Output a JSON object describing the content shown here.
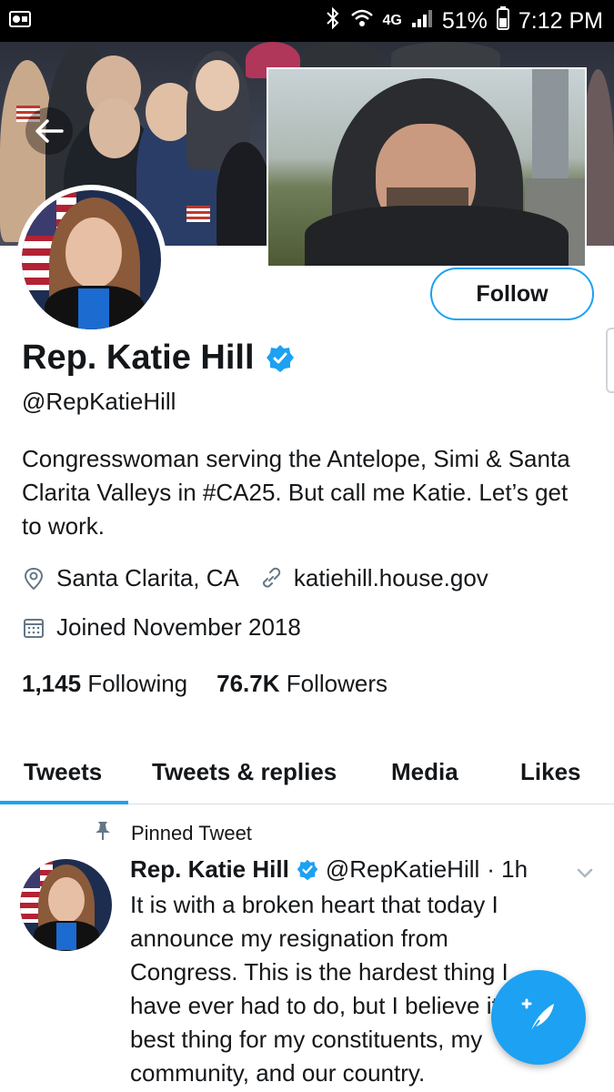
{
  "status_bar": {
    "network": "4G",
    "battery": "51%",
    "time": "7:12 PM"
  },
  "profile": {
    "name": "Rep. Katie Hill",
    "handle": "@RepKatieHill",
    "bio": "Congresswoman serving the Antelope, Simi & Santa Clarita Valleys in #CA25. But call me Katie. Let’s get to work.",
    "location": "Santa Clarita, CA",
    "website": "katiehill.house.gov",
    "joined": "Joined November 2018",
    "following_count": "1,145",
    "following_label": "Following",
    "followers_count": "76.7K",
    "followers_label": "Followers",
    "follow_button": "Follow"
  },
  "tabs": [
    {
      "label": "Tweets",
      "active": true
    },
    {
      "label": "Tweets & replies",
      "active": false
    },
    {
      "label": "Media",
      "active": false
    },
    {
      "label": "Likes",
      "active": false
    }
  ],
  "pinned_tweet": {
    "pinned_label": "Pinned Tweet",
    "author_name": "Rep. Katie Hill",
    "author_handle": "@RepKatieHill",
    "time": "· 1h",
    "lines": [
      "It is with a broken heart that today I",
      "announce my resignation from",
      "Congress. This is the hardest thing I",
      "have ever had to do, but I believe it's the",
      "best thing for my constituents, my",
      "community, and our country."
    ]
  },
  "colors": {
    "accent": "#1da1f2",
    "text": "#14171a",
    "muted": "#657786"
  }
}
